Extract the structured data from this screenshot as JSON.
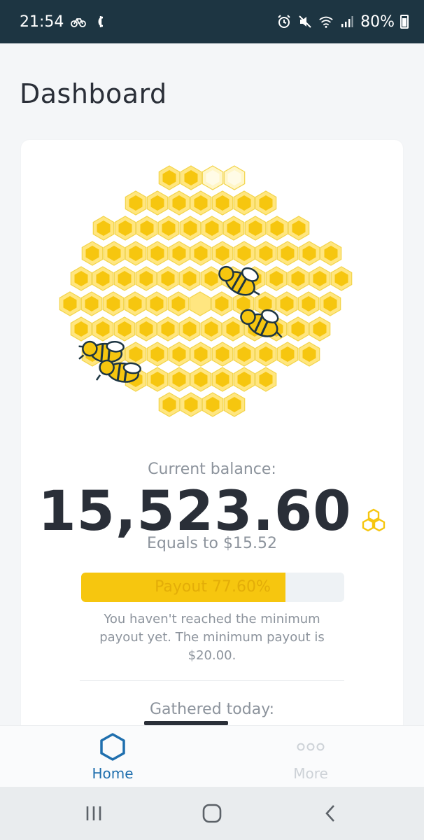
{
  "status_bar": {
    "time": "21:54",
    "battery": "80%",
    "icons": [
      "bicycle-icon",
      "currency-icon",
      "alarm-icon",
      "mute-icon",
      "wifi-icon",
      "signal-icon",
      "battery-icon"
    ]
  },
  "header": {
    "title": "Dashboard"
  },
  "balance": {
    "label": "Current balance:",
    "value": "15,523.60",
    "equals": "Equals to $15.52",
    "currency_icon": "honeycomb-coin-icon"
  },
  "payout": {
    "label": "Payout 77.60%",
    "progress_percent": 77.6,
    "note": "You haven't reached the minimum payout yet. The minimum payout is $20.00."
  },
  "gathered": {
    "label": "Gathered today:"
  },
  "bottom_nav": {
    "items": [
      {
        "label": "Home",
        "icon": "hexagon-icon",
        "active": true
      },
      {
        "label": "More",
        "icon": "more-dots-icon",
        "active": false
      }
    ]
  },
  "system_nav": {
    "icons": [
      "recents-icon",
      "home-icon",
      "back-icon"
    ]
  },
  "colors": {
    "accent": "#1f6fae",
    "honey": "#f6c60f",
    "honey_light": "#fff6c8",
    "status_bar": "#1d3542",
    "text_dark": "#2a2f38",
    "text_muted": "#8c939c"
  }
}
